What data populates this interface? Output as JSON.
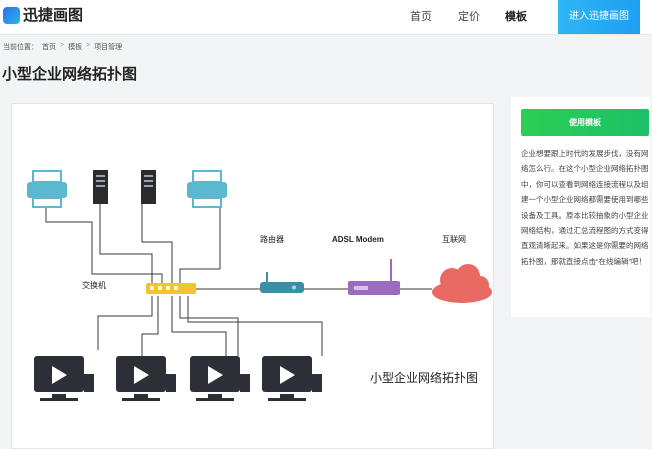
{
  "header": {
    "logo_text": "迅捷画图",
    "nav": [
      "首页",
      "定价",
      "模板"
    ],
    "active_nav": "模板",
    "cta_label": "进入迅捷画图"
  },
  "breadcrumb": {
    "prefix": "当前位置：",
    "items": [
      "首页",
      "模板",
      "项目管理"
    ],
    "separator": ">"
  },
  "page_title": "小型企业网络拓扑图",
  "diagram": {
    "labels": {
      "switch": "交换机",
      "router": "路由器",
      "modem": "ADSL Modem",
      "internet": "互联网",
      "caption": "小型企业网络拓扑图"
    },
    "colors": {
      "printer": "#5cb8d1",
      "server": "#2b2b2b",
      "switch": "#f4c430",
      "router": "#3a8fa6",
      "modem": "#9b6bbf",
      "cloud": "#e86a63",
      "computer": "#2c2f36"
    }
  },
  "sidebar": {
    "use_button": "使用模板",
    "description": "企业想要跟上时代的发展步伐，没有网络怎么行。在这个小型企业网络拓扑图中，你可以查看到网络连接流程以及组建一个小型企业网络都需要使用到哪些设备及工具。原本比较抽象的小型企业网络结构，通过汇总流程图的方式变得直观清晰起来。如果这是你需要的网络拓扑图，那就直接点击“在线编辑”吧！"
  }
}
